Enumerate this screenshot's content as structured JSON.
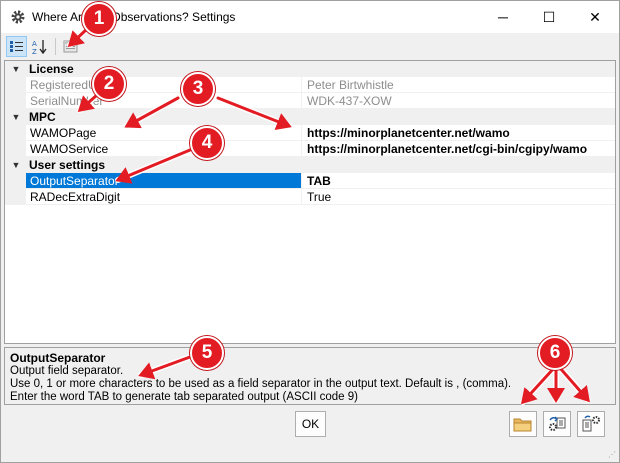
{
  "window": {
    "title": "Where Are My Observations? Settings",
    "min_glyph": "─",
    "max_glyph": "☐",
    "close_glyph": "✕"
  },
  "toolbar": {
    "categorized_icon": "categorized-icon",
    "alphabetical_icon": "alphabetical-icon",
    "property_pages_icon": "property-pages-icon"
  },
  "grid": {
    "categories": {
      "license": "License",
      "mpc": "MPC",
      "user_settings": "User settings"
    },
    "properties": {
      "registered_user": {
        "name": "RegisteredUser",
        "value": "Peter Birtwhistle"
      },
      "serial_number": {
        "name": "SerialNumber",
        "value": "WDK-437-XOW"
      },
      "wamo_page": {
        "name": "WAMOPage",
        "value": "https://minorplanetcenter.net/wamo"
      },
      "wamo_service": {
        "name": "WAMOService",
        "value": "https://minorplanetcenter.net/cgi-bin/cgipy/wamo"
      },
      "output_separator": {
        "name": "OutputSeparator",
        "value": "TAB"
      },
      "radec_extra_digit": {
        "name": "RADecExtraDigit",
        "value": "True"
      }
    }
  },
  "description": {
    "title": "OutputSeparator",
    "lines": [
      "Output field separator.",
      "Use 0, 1 or more characters to be used as a field separator in the output text. Default is , (comma).",
      "Enter the word TAB to generate tab separated output (ASCII code 9)"
    ]
  },
  "buttons": {
    "ok_label": "OK",
    "open_folder_icon": "folder-icon",
    "export_settings_icon": "export-settings-icon",
    "import_settings_icon": "import-settings-icon"
  },
  "annotations": {
    "badges": [
      "1",
      "2",
      "3",
      "4",
      "5",
      "6"
    ],
    "color": "#e31b23"
  },
  "colors": {
    "selection": "#0078d7",
    "category_bg": "#f0f0f0",
    "readonly_text": "#8d8d8d"
  }
}
